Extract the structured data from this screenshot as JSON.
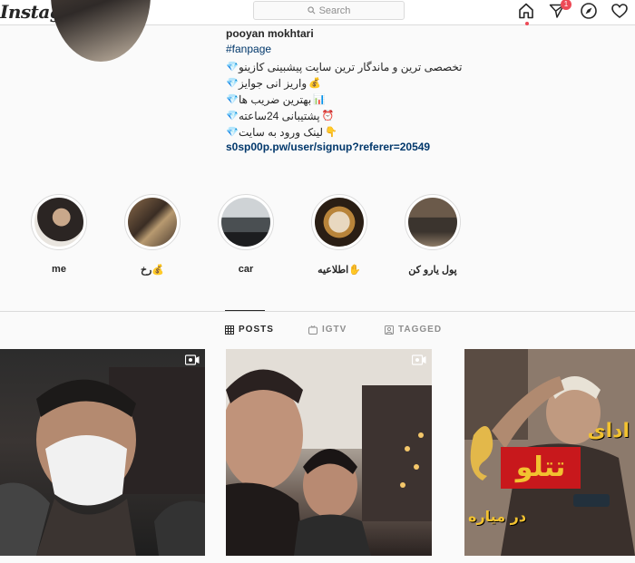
{
  "app": {
    "logo": "Instagram"
  },
  "search": {
    "placeholder": "Search"
  },
  "nav": {
    "home_icon": "home-icon",
    "direct_icon": "direct-icon",
    "direct_badge": "1",
    "explore_icon": "compass-icon",
    "activity_icon": "heart-icon"
  },
  "profile": {
    "username": "pooyan mokhtari",
    "hashtag": "#fanpage",
    "bio_lines": [
      {
        "emoji": "💎",
        "text": "تخصصی ترین و ماندگار ترین سایت پیشبینی کازینو"
      },
      {
        "emoji": "💰",
        "text": "واریز انی جوایز"
      },
      {
        "emoji": "📊",
        "text": "بهترین ضریب ها"
      },
      {
        "emoji": "⏰",
        "text": "پشتیبانی 24ساعته"
      },
      {
        "emoji": "👇",
        "text": "لینک ورود به سایت"
      }
    ],
    "link": "s0sp00p.pw/user/signup?referer=20549"
  },
  "highlights": [
    {
      "label": "me"
    },
    {
      "label": "رخ💰"
    },
    {
      "label": "car"
    },
    {
      "label": "اطلاعیه✋"
    },
    {
      "label": "پول یارو کن"
    }
  ],
  "tabs": [
    {
      "label": "POSTS",
      "icon": "grid-icon"
    },
    {
      "label": "IGTV",
      "icon": "igtv-icon"
    },
    {
      "label": "TAGGED",
      "icon": "tagged-icon"
    }
  ],
  "posts": [
    {
      "type": "video"
    },
    {
      "type": "video"
    },
    {
      "type": "image",
      "overlay_lines": [
        "ادای",
        "تتلو",
        "در میاره"
      ]
    }
  ],
  "colors": {
    "link": "#00376b",
    "badge": "#ed4956",
    "border": "#dbdbdb",
    "muted": "#8e8e8e"
  }
}
